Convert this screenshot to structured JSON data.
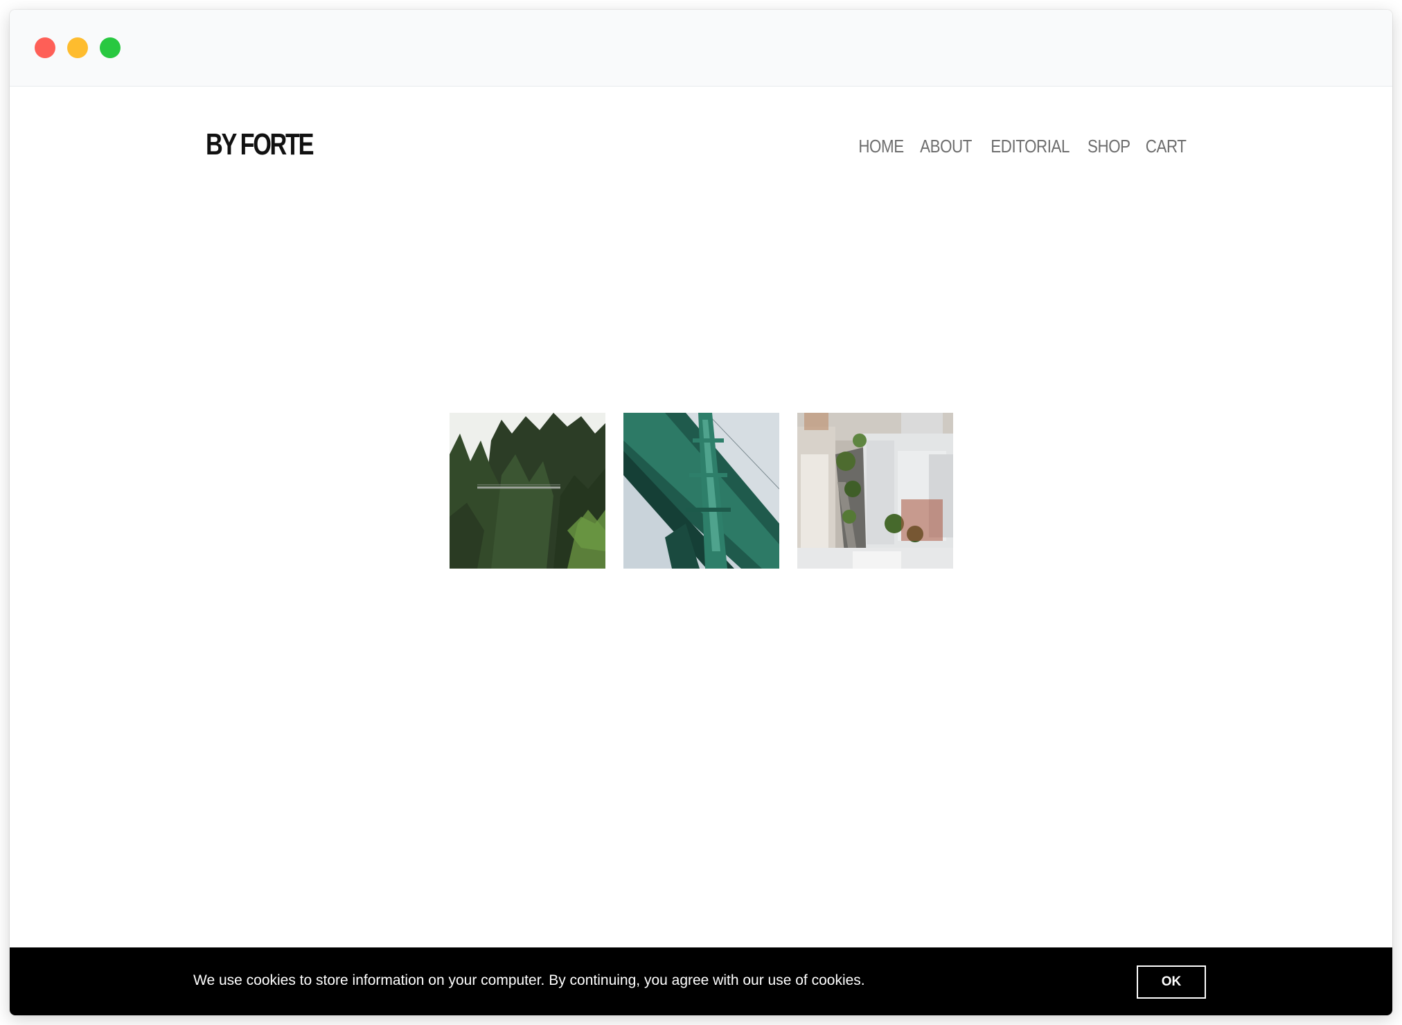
{
  "window": {
    "controls": {
      "close_color": "#fe5f57",
      "minimize_color": "#febc2e",
      "maximize_color": "#28c840"
    }
  },
  "header": {
    "logo": "BY FORTE",
    "nav": [
      {
        "label": "HOME"
      },
      {
        "label": "ABOUT"
      },
      {
        "label": "EDITORIAL"
      },
      {
        "label": "SHOP"
      },
      {
        "label": "CART"
      }
    ]
  },
  "gallery": {
    "images": [
      {
        "icon": "forest-suspension-bridge-photo"
      },
      {
        "icon": "green-bridge-tower-photo"
      },
      {
        "icon": "city-street-aerial-photo"
      }
    ]
  },
  "cookie_banner": {
    "message": "We use cookies to store information on your computer. By continuing, you agree with our use of cookies.",
    "ok_label": "OK"
  }
}
